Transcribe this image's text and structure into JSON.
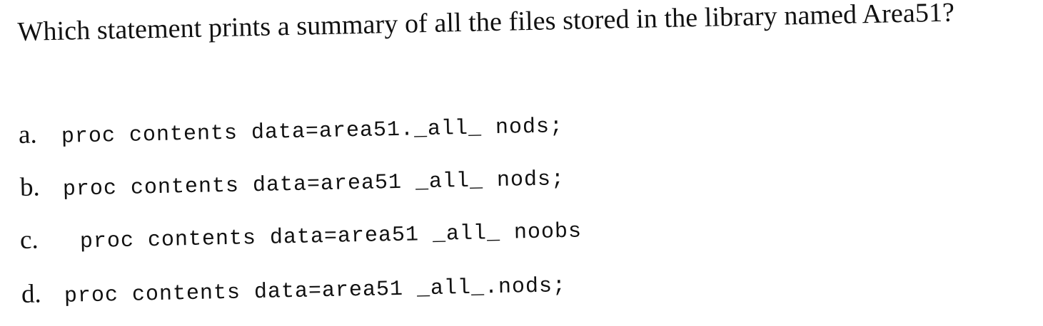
{
  "question": {
    "text": "Which statement prints a summary of all the files stored in the library named Area51?"
  },
  "options": [
    {
      "letter": "a.",
      "code": "proc contents data=area51._all_ nods;"
    },
    {
      "letter": "b.",
      "code": "proc contents data=area51 _all_ nods;"
    },
    {
      "letter": "c.",
      "code": "proc contents data=area51 _all_ noobs"
    },
    {
      "letter": "d.",
      "code": "proc contents data=area51 _all_.nods;"
    }
  ]
}
